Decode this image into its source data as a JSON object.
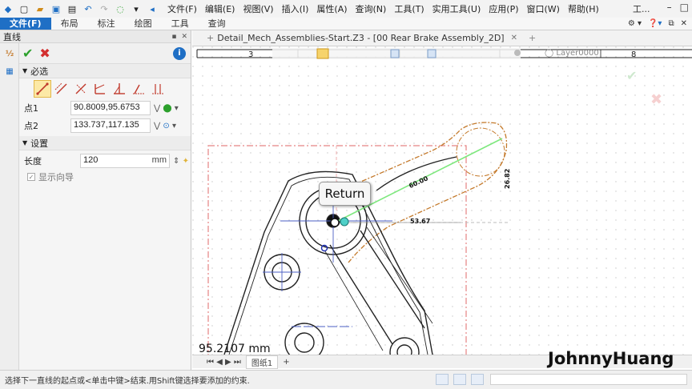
{
  "menu_bar": {
    "items": [
      "文件(F)",
      "编辑(E)",
      "视图(V)",
      "插入(I)",
      "属性(A)",
      "查询(N)",
      "工具(T)",
      "实用工具(U)",
      "应用(P)",
      "窗口(W)",
      "帮助(H)"
    ],
    "window_title": "工..."
  },
  "ribbon": {
    "tabs": [
      "文件(F)",
      "布局",
      "标注",
      "绘图",
      "工具",
      "查询"
    ],
    "active_tab": "文件(F)"
  },
  "panel": {
    "title": "直线",
    "required_section": "必选",
    "point1_label": "点1",
    "point1_value": "90.8009,95.6753",
    "point2_label": "点2",
    "point2_value": "133.737,117.135",
    "settings_section": "设置",
    "length_label": "长度",
    "length_value": "120",
    "length_unit": "mm",
    "show_guide_label": "显示向导",
    "show_guide_checked": true,
    "info_icon": "info-icon",
    "mode_icons": [
      "line-two-point-icon",
      "line-parallel-icon",
      "line-perpendicular-icon",
      "line-angle-icon",
      "line-tangent-icon",
      "line-bisector-icon",
      "line-horizontal-icon"
    ]
  },
  "document": {
    "tab_label": "Detail_Mech_Assemblies-Start.Z3 - [00 Rear Brake Assembly_2D]",
    "layer": "Layer0000"
  },
  "canvas": {
    "dimension_60": "60.00",
    "dimension_26": "26.82",
    "dimension_53": "53.67",
    "return_button": "Return",
    "coordinate_readout": "95.2107 mm"
  },
  "sheet_tabs": {
    "current": "图纸1"
  },
  "watermark": "JohnnyHuang",
  "status_bar": {
    "message": "选择下一直线的起点或<单击中键>结束.用Shift键选择要添加的约束."
  },
  "colors": {
    "accent": "#1f6fc5",
    "ok_green": "#2ca02c",
    "cancel_red": "#d32f2f",
    "constraint_orange": "#c47a2c",
    "guide_green": "#7ee87e"
  }
}
